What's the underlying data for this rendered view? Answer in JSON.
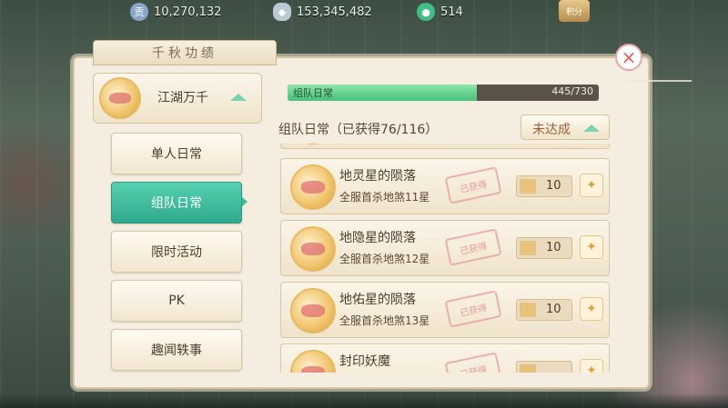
{
  "resources": [
    {
      "icon": "silver-coin-icon",
      "value": "10,270,132"
    },
    {
      "icon": "ingot-icon",
      "value": "153,345,482"
    },
    {
      "icon": "jade-icon",
      "value": "514"
    }
  ],
  "score_badge": {
    "icon": "score-badge-icon",
    "label": "积分"
  },
  "panel_title": "千秋功绩",
  "close_icon": "×",
  "category": {
    "label": "江湖万千"
  },
  "tabs": [
    "单人日常",
    "组队日常",
    "限时活动",
    "PK",
    "趣闻轶事"
  ],
  "active_tab_index": 1,
  "progress": {
    "label": "组队日常",
    "value_text": "445/730",
    "fraction": 0.6096
  },
  "section": {
    "title": "组队日常（已获得76/116）",
    "status": "未达成"
  },
  "achievements": [
    {
      "name": "地灵星的陨落",
      "desc": "全服首杀地煞11星",
      "stamp": "已获得",
      "reward": "10"
    },
    {
      "name": "地隐星的陨落",
      "desc": "全服首杀地煞12星",
      "stamp": "已获得",
      "reward": "10"
    },
    {
      "name": "地佑星的陨落",
      "desc": "全服首杀地煞13星",
      "stamp": "已获得",
      "reward": "10"
    },
    {
      "name": "封印妖魔",
      "desc": "",
      "stamp": "已获得",
      "reward": ""
    }
  ],
  "colors": {
    "accent_green": "#3dbb9c",
    "progress_fill": "#45c27b",
    "close_red": "#e4595c",
    "panel_bg": "#f4ede0"
  }
}
